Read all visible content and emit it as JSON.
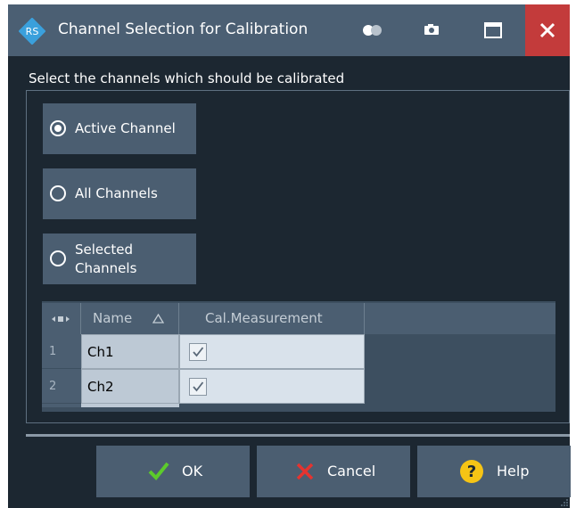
{
  "window": {
    "title": "Channel Selection for Calibration"
  },
  "titlebar_icons": [
    "toggle-icon",
    "camera-icon",
    "maximize-icon",
    "close-icon"
  ],
  "prompt": "Select the channels which should be calibrated",
  "options": [
    {
      "label": "Active Channel",
      "selected": true
    },
    {
      "label": "All Channels",
      "selected": false
    },
    {
      "label_line1": "Selected",
      "label_line2": "Channels",
      "selected": false
    }
  ],
  "table": {
    "columns": [
      "Name",
      "Cal.Measurement"
    ],
    "rows": [
      {
        "num": "1",
        "name": "Ch1",
        "cal": true
      },
      {
        "num": "2",
        "name": "Ch2",
        "cal": true
      }
    ]
  },
  "buttons": {
    "ok": "OK",
    "cancel": "Cancel",
    "help": "Help"
  },
  "colors": {
    "accent_red": "#c33b3b",
    "ok_green": "#5ccb2b",
    "cancel_red": "#e5332f",
    "help_yellow": "#f6c415"
  }
}
